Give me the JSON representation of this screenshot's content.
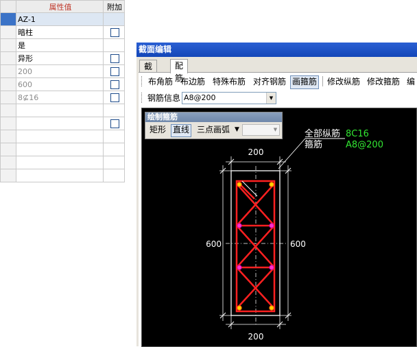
{
  "grid": {
    "header": {
      "value": "属性值",
      "add": "附加"
    },
    "rows": [
      {
        "value": "AZ-1",
        "checkbox": false
      },
      {
        "value": "暗柱",
        "checkbox": true
      },
      {
        "value": "是",
        "checkbox": false
      },
      {
        "value": "异形",
        "checkbox": true
      },
      {
        "value": "200",
        "checkbox": true
      },
      {
        "value": "600",
        "checkbox": true
      },
      {
        "value": "8⊈16",
        "checkbox": true
      },
      {
        "value": "",
        "checkbox": false
      },
      {
        "value": "",
        "checkbox": true
      },
      {
        "value": "",
        "checkbox": false
      },
      {
        "value": "",
        "checkbox": false
      },
      {
        "value": "",
        "checkbox": false
      },
      {
        "value": "",
        "checkbox": false
      }
    ]
  },
  "window": {
    "title": "截面编辑"
  },
  "tabs": {
    "section": "截面",
    "rebar": "配筋"
  },
  "toolbar": {
    "corner": "布角筋",
    "edge": "布边筋",
    "special": "特殊布筋",
    "align": "对齐钢筋",
    "stirrup": "画箍筋",
    "edit_long": "修改纵筋",
    "edit_stirrup": "修改箍筋",
    "edit_more": "编"
  },
  "rebar_info": {
    "label": "钢筋信息",
    "value": "A8@200"
  },
  "draw_panel": {
    "title": "绘制箍筋",
    "rect": "矩形",
    "line": "直线",
    "arc": "三点画弧"
  },
  "drawing": {
    "dim_top": "200",
    "dim_bottom": "200",
    "dim_left": "600",
    "dim_right": "600",
    "callout_long_label": "全部纵筋",
    "callout_long_value": "8C16",
    "callout_stirrup_label": "箍筋",
    "callout_stirrup_value": "A8@200"
  },
  "colors": {
    "titlebar": "#1f55c8",
    "rebar": "#ff2020",
    "dimension": "#ffffff",
    "value_text": "#32e632",
    "canvas": "#000000"
  }
}
